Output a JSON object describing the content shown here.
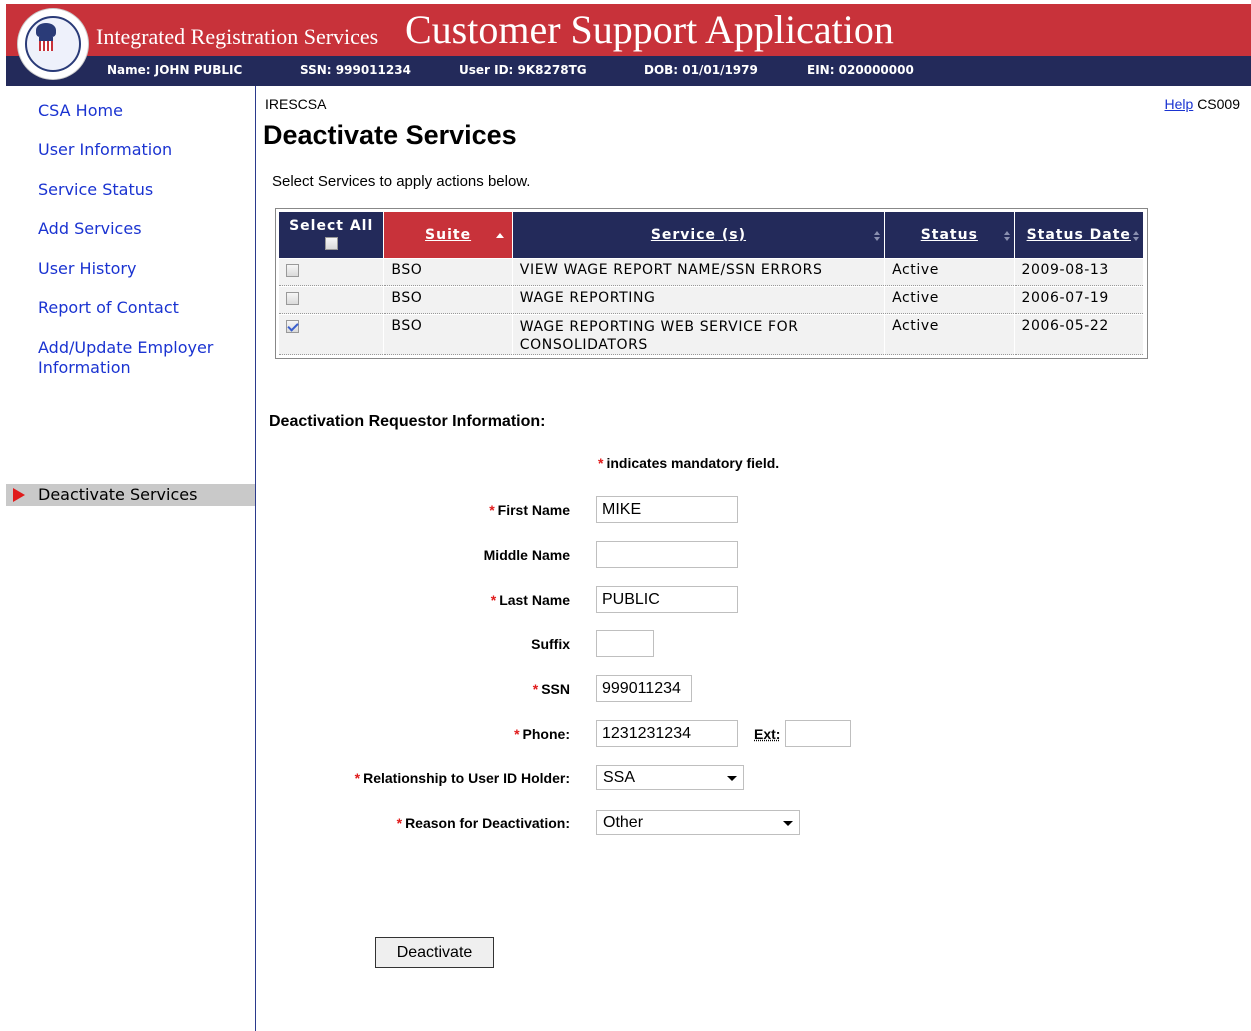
{
  "header": {
    "logo_alt": "Social Security Administration seal",
    "app_name": "Integrated Registration Services",
    "app_title": "Customer Support Application",
    "user_info": {
      "name": "Name: JOHN PUBLIC",
      "ssn": "SSN: 999011234",
      "user_id": "User ID: 9K8278TG",
      "dob": "DOB: 01/01/1979",
      "ein": "EIN: 020000000"
    },
    "colors": {
      "red": "#c8323a",
      "navy": "#232a5a"
    }
  },
  "sidebar": {
    "items": [
      {
        "label": "CSA Home"
      },
      {
        "label": "User Information"
      },
      {
        "label": "Service Status"
      },
      {
        "label": "Add Services"
      },
      {
        "label": "User History"
      },
      {
        "label": "Report of Contact"
      },
      {
        "label": "Add/Update Employer Information"
      }
    ],
    "active": {
      "label": "Deactivate Services",
      "indicator_icon": "red-triangle-arrow"
    }
  },
  "page": {
    "breadcrumb": "IRESCSA",
    "help_label": "Help",
    "screen_code": "CS009",
    "title": "Deactivate Services",
    "instructions": "Select Services to apply actions below."
  },
  "table": {
    "headers": {
      "select_all": "Select All",
      "suite": "Suite",
      "service": "Service (s)",
      "status": "Status",
      "status_date": "Status Date"
    },
    "sorted_column": "Suite",
    "rows": [
      {
        "checked": false,
        "suite": "BSO",
        "service": "VIEW WAGE REPORT NAME/SSN ERRORS",
        "status": "Active",
        "date": "2009-08-13"
      },
      {
        "checked": false,
        "suite": "BSO",
        "service": "WAGE REPORTING",
        "status": "Active",
        "date": "2006-07-19"
      },
      {
        "checked": true,
        "suite": "BSO",
        "service": "WAGE REPORTING WEB SERVICE FOR CONSOLIDATORS",
        "status": "Active",
        "date": "2006-05-22"
      }
    ]
  },
  "form": {
    "section_title": "Deactivation Requestor Information:",
    "mandatory_star": "*",
    "mandatory_note": "indicates mandatory field.",
    "fields": {
      "first_name": {
        "label": "First Name",
        "value": "MIKE",
        "required": true
      },
      "middle_name": {
        "label": "Middle Name",
        "value": "",
        "required": false
      },
      "last_name": {
        "label": "Last Name",
        "value": "PUBLIC",
        "required": true
      },
      "suffix": {
        "label": "Suffix",
        "value": "",
        "required": false
      },
      "ssn": {
        "label": "SSN",
        "value": "999011234",
        "required": true
      },
      "phone": {
        "label": "Phone:",
        "value": "1231231234",
        "required": true
      },
      "ext": {
        "label": "Ext:",
        "value": ""
      },
      "relationship": {
        "label": "Relationship to User ID Holder:",
        "value": "SSA",
        "required": true
      },
      "reason": {
        "label": "Reason for Deactivation:",
        "value": "Other",
        "required": true
      }
    },
    "submit_label": "Deactivate"
  }
}
